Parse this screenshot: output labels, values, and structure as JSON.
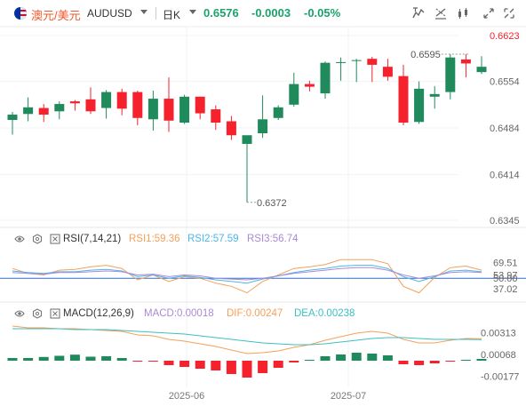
{
  "toolbar": {
    "pair_cn": "澳元/美元",
    "pair_en": "AUDUSD",
    "timeframe": "日K",
    "last_price": "0.6576",
    "change": "-0.0003",
    "change_pct": "-0.05%",
    "icons": [
      "flag-icon",
      "dropdown-caret-icon",
      "timeframe-caret-icon",
      "indicator-icon",
      "compare-icon",
      "draw-icon",
      "layout-icon",
      "fullscreen-icon",
      "close-icon"
    ]
  },
  "colors": {
    "up": "#1f8a5b",
    "down": "#f5222d",
    "rsi1": "#f5a05a",
    "rsi2": "#4db6e8",
    "rsi3": "#a98ad8",
    "macd_line": "#f5a05a",
    "signal_line": "#3cc0c0",
    "price_axis_red": "#f5222d",
    "accent_green": "#1aa36b",
    "ref_line": "#2f6fd0"
  },
  "rsi_legend": {
    "label": "RSI(7,14,21)",
    "rsi1": "RSI1:59.36",
    "rsi2": "RSI2:57.59",
    "rsi3": "RSI3:56.74"
  },
  "macd_legend": {
    "label": "MACD(12,26,9)",
    "macd": "MACD:0.00018",
    "dif": "DIF:0.00247",
    "dea": "DEA:0.00238"
  },
  "chart_data": [
    {
      "type": "candlestick",
      "ylim": [
        0.6345,
        0.6623
      ],
      "y_ticks": [
        "0.6623",
        "0.6554",
        "0.6484",
        "0.6414",
        "0.6345"
      ],
      "x_ticks": [
        "2025-06",
        "2025-07"
      ],
      "annotations": [
        {
          "text": "0.6595",
          "value": 0.6595,
          "kind": "high"
        },
        {
          "text": "0.6372",
          "value": 0.6372,
          "kind": "low"
        }
      ],
      "candles": [
        {
          "o": 0.6496,
          "h": 0.6508,
          "l": 0.6474,
          "c": 0.6504
        },
        {
          "o": 0.6505,
          "h": 0.653,
          "l": 0.6494,
          "c": 0.6515
        },
        {
          "o": 0.6514,
          "h": 0.652,
          "l": 0.6493,
          "c": 0.6504
        },
        {
          "o": 0.6509,
          "h": 0.6524,
          "l": 0.6497,
          "c": 0.652
        },
        {
          "o": 0.6524,
          "h": 0.6526,
          "l": 0.651,
          "c": 0.6521
        },
        {
          "o": 0.6527,
          "h": 0.6545,
          "l": 0.6505,
          "c": 0.6509
        },
        {
          "o": 0.6514,
          "h": 0.6541,
          "l": 0.6498,
          "c": 0.6538
        },
        {
          "o": 0.6538,
          "h": 0.6543,
          "l": 0.6503,
          "c": 0.6513
        },
        {
          "o": 0.6538,
          "h": 0.654,
          "l": 0.6488,
          "c": 0.6499
        },
        {
          "o": 0.6497,
          "h": 0.654,
          "l": 0.648,
          "c": 0.6528
        },
        {
          "o": 0.6528,
          "h": 0.656,
          "l": 0.6478,
          "c": 0.6495
        },
        {
          "o": 0.6492,
          "h": 0.6534,
          "l": 0.649,
          "c": 0.6531
        },
        {
          "o": 0.6531,
          "h": 0.6531,
          "l": 0.6497,
          "c": 0.6506
        },
        {
          "o": 0.6512,
          "h": 0.6518,
          "l": 0.6481,
          "c": 0.6492
        },
        {
          "o": 0.6494,
          "h": 0.6502,
          "l": 0.6466,
          "c": 0.6473
        },
        {
          "o": 0.646,
          "h": 0.6463,
          "l": 0.6372,
          "c": 0.6473
        },
        {
          "o": 0.6476,
          "h": 0.6533,
          "l": 0.6469,
          "c": 0.6497
        },
        {
          "o": 0.6499,
          "h": 0.6518,
          "l": 0.6496,
          "c": 0.6515
        },
        {
          "o": 0.6519,
          "h": 0.6567,
          "l": 0.6516,
          "c": 0.655
        },
        {
          "o": 0.655,
          "h": 0.6555,
          "l": 0.6539,
          "c": 0.6546
        },
        {
          "o": 0.6536,
          "h": 0.6584,
          "l": 0.6528,
          "c": 0.6582
        },
        {
          "o": 0.6583,
          "h": 0.659,
          "l": 0.6555,
          "c": 0.6583
        },
        {
          "o": 0.6586,
          "h": 0.6588,
          "l": 0.6553,
          "c": 0.6586
        },
        {
          "o": 0.6588,
          "h": 0.6591,
          "l": 0.6553,
          "c": 0.6579
        },
        {
          "o": 0.6576,
          "h": 0.6588,
          "l": 0.6555,
          "c": 0.6561
        },
        {
          "o": 0.6562,
          "h": 0.6579,
          "l": 0.6488,
          "c": 0.6492
        },
        {
          "o": 0.6493,
          "h": 0.6554,
          "l": 0.649,
          "c": 0.6543
        },
        {
          "o": 0.6531,
          "h": 0.6547,
          "l": 0.6513,
          "c": 0.6535
        },
        {
          "o": 0.6538,
          "h": 0.6595,
          "l": 0.6527,
          "c": 0.659
        },
        {
          "o": 0.6587,
          "h": 0.6595,
          "l": 0.656,
          "c": 0.6581
        },
        {
          "o": 0.6568,
          "h": 0.6592,
          "l": 0.6565,
          "c": 0.6576
        }
      ]
    },
    {
      "type": "line",
      "title": "RSI(7,14,21)",
      "y_ticks": [
        "69.51",
        "53.97",
        "50.00",
        "37.02"
      ],
      "series": [
        {
          "name": "RSI1",
          "values": [
            62,
            56,
            54,
            60,
            61,
            64,
            66,
            62,
            48,
            54,
            46,
            52,
            50,
            44,
            40,
            32,
            46,
            54,
            62,
            64,
            67,
            73,
            73,
            73,
            68,
            40,
            32,
            51,
            63,
            65,
            60
          ]
        },
        {
          "name": "RSI2",
          "values": [
            59,
            57,
            56,
            58,
            58,
            60,
            61,
            59,
            52,
            54,
            50,
            53,
            51,
            48,
            46,
            44,
            49,
            53,
            57,
            60,
            62,
            65,
            66,
            66,
            62,
            52,
            46,
            52,
            59,
            60,
            58
          ]
        },
        {
          "name": "RSI3",
          "values": [
            57,
            56,
            55,
            57,
            57,
            58,
            59,
            58,
            54,
            55,
            52,
            54,
            53,
            50,
            49,
            48,
            50,
            53,
            56,
            58,
            60,
            62,
            63,
            63,
            60,
            54,
            50,
            53,
            57,
            58,
            57
          ]
        }
      ]
    },
    {
      "type": "bar",
      "title": "MACD(12,26,9)",
      "y_ticks": [
        "0.00313",
        "0.00068",
        "-0.00177"
      ],
      "x_ticks": [
        "2025-06",
        "2025-07"
      ],
      "histogram": [
        0.0003,
        0.0003,
        0.00042,
        0.00055,
        0.00068,
        0.00045,
        0.0005,
        0.0003,
        -0.0001,
        -0.0001,
        -0.0005,
        -0.0007,
        -0.0009,
        -0.0011,
        -0.0015,
        -0.0019,
        -0.0014,
        -0.0008,
        -0.0002,
        0.0001,
        0.0005,
        0.0007,
        0.0009,
        0.0008,
        0.0006,
        -0.0004,
        -0.0005,
        -0.0003,
        -0.0001,
        0.0001,
        0.0002
      ],
      "series": [
        {
          "name": "DIF",
          "values": [
            0.0039,
            0.0037,
            0.0037,
            0.0036,
            0.0036,
            0.0035,
            0.0034,
            0.0033,
            0.0029,
            0.0028,
            0.0024,
            0.0022,
            0.0019,
            0.0016,
            0.0012,
            0.0008,
            0.0009,
            0.0011,
            0.0015,
            0.0018,
            0.0023,
            0.0027,
            0.0031,
            0.0033,
            0.0031,
            0.0024,
            0.002,
            0.002,
            0.0023,
            0.0025,
            0.00247
          ]
        },
        {
          "name": "DEA",
          "values": [
            0.0036,
            0.0036,
            0.0036,
            0.0036,
            0.0035,
            0.0035,
            0.0035,
            0.0034,
            0.0033,
            0.0032,
            0.0031,
            0.003,
            0.0028,
            0.0026,
            0.0024,
            0.0022,
            0.002,
            0.0019,
            0.0018,
            0.0018,
            0.0019,
            0.0021,
            0.0023,
            0.0025,
            0.0026,
            0.0026,
            0.0025,
            0.0024,
            0.0024,
            0.0024,
            0.00238
          ]
        }
      ]
    }
  ]
}
